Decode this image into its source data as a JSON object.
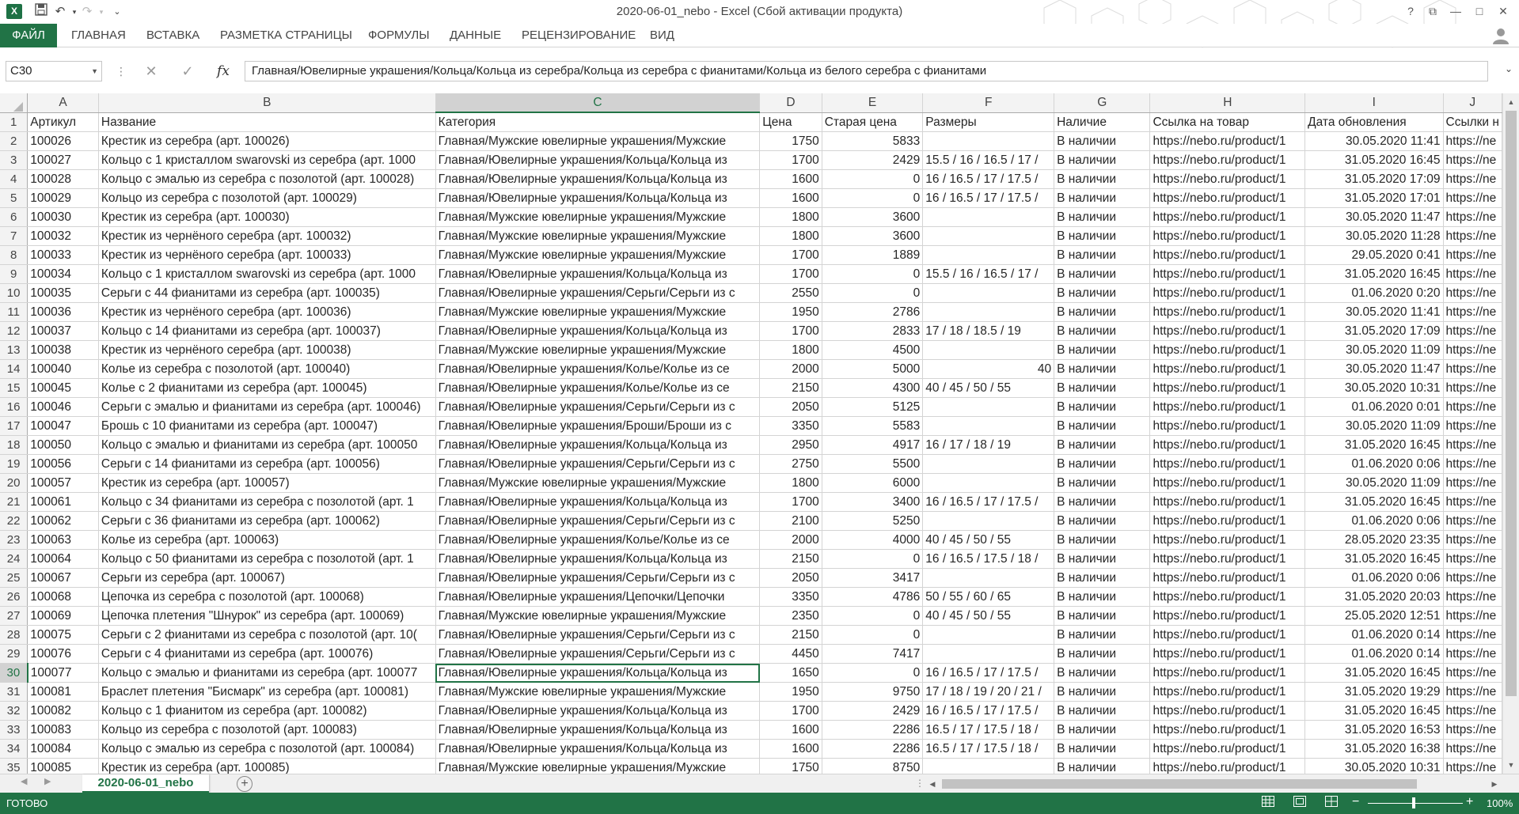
{
  "window": {
    "title": "2020-06-01_nebo - Excel (Сбой активации продукта)",
    "app_icon": "X",
    "help": "?",
    "restore": "⧉",
    "minimize": "—",
    "maximize": "□",
    "close": "✕"
  },
  "qat": {
    "save_icon": "💾",
    "undo_icon": "↶",
    "redo_icon": "↷",
    "customize_icon": "⌄"
  },
  "ribbon": {
    "tabs": [
      "ФАЙЛ",
      "ГЛАВНАЯ",
      "ВСТАВКА",
      "РАЗМЕТКА СТРАНИЦЫ",
      "ФОРМУЛЫ",
      "ДАННЫЕ",
      "РЕЦЕНЗИРОВАНИЕ",
      "ВИД"
    ]
  },
  "formula_bar": {
    "name_box": "C30",
    "cancel": "✕",
    "enter": "✓",
    "fx": "fx",
    "formula": "Главная/Ювелирные украшения/Кольца/Кольца из серебра/Кольца из серебра с фианитами/Кольца из белого серебра с фианитами"
  },
  "columns": [
    "A",
    "B",
    "C",
    "D",
    "E",
    "F",
    "G",
    "H",
    "I",
    "J"
  ],
  "selected_column": "C",
  "selected_row": 30,
  "header_row": [
    "Артикул",
    "Название",
    "Категория",
    "Цена",
    "Старая цена",
    "Размеры",
    "Наличие",
    "Ссылка на товар",
    "Дата обновления",
    "Ссылки н"
  ],
  "rows": [
    [
      "100026",
      "Крестик из серебра (арт. 100026)",
      "Главная/Мужские ювелирные украшения/Мужские",
      "1750",
      "5833",
      "",
      "В наличии",
      "https://nebo.ru/product/1",
      "30.05.2020 11:41",
      "https://ne"
    ],
    [
      "100027",
      "Кольцо с 1 кристаллом swarovski из серебра (арт. 1000",
      "Главная/Ювелирные украшения/Кольца/Кольца из",
      "1700",
      "2429",
      "15.5 / 16 / 16.5 / 17 /",
      "В наличии",
      "https://nebo.ru/product/1",
      "31.05.2020 16:45",
      "https://ne"
    ],
    [
      "100028",
      "Кольцо с эмалью из серебра с позолотой (арт. 100028)",
      "Главная/Ювелирные украшения/Кольца/Кольца из",
      "1600",
      "0",
      "16 / 16.5 / 17 / 17.5 /",
      "В наличии",
      "https://nebo.ru/product/1",
      "31.05.2020 17:09",
      "https://ne"
    ],
    [
      "100029",
      "Кольцо из серебра с позолотой (арт. 100029)",
      "Главная/Ювелирные украшения/Кольца/Кольца из",
      "1600",
      "0",
      "16 / 16.5 / 17 / 17.5 /",
      "В наличии",
      "https://nebo.ru/product/1",
      "31.05.2020 17:01",
      "https://ne"
    ],
    [
      "100030",
      "Крестик из серебра (арт. 100030)",
      "Главная/Мужские ювелирные украшения/Мужские",
      "1800",
      "3600",
      "",
      "В наличии",
      "https://nebo.ru/product/1",
      "30.05.2020 11:47",
      "https://ne"
    ],
    [
      "100032",
      "Крестик из чернёного серебра (арт. 100032)",
      "Главная/Мужские ювелирные украшения/Мужские",
      "1800",
      "3600",
      "",
      "В наличии",
      "https://nebo.ru/product/1",
      "30.05.2020 11:28",
      "https://ne"
    ],
    [
      "100033",
      "Крестик из чернёного серебра (арт. 100033)",
      "Главная/Мужские ювелирные украшения/Мужские",
      "1700",
      "1889",
      "",
      "В наличии",
      "https://nebo.ru/product/1",
      "29.05.2020 0:41",
      "https://ne"
    ],
    [
      "100034",
      "Кольцо с 1 кристаллом swarovski из серебра (арт. 1000",
      "Главная/Ювелирные украшения/Кольца/Кольца из",
      "1700",
      "0",
      "15.5 / 16 / 16.5 / 17 /",
      "В наличии",
      "https://nebo.ru/product/1",
      "31.05.2020 16:45",
      "https://ne"
    ],
    [
      "100035",
      "Серьги с 44 фианитами из серебра (арт. 100035)",
      "Главная/Ювелирные украшения/Серьги/Серьги из с",
      "2550",
      "0",
      "",
      "В наличии",
      "https://nebo.ru/product/1",
      "01.06.2020 0:20",
      "https://ne"
    ],
    [
      "100036",
      "Крестик из чернёного серебра (арт. 100036)",
      "Главная/Мужские ювелирные украшения/Мужские",
      "1950",
      "2786",
      "",
      "В наличии",
      "https://nebo.ru/product/1",
      "30.05.2020 11:41",
      "https://ne"
    ],
    [
      "100037",
      "Кольцо с 14 фианитами из серебра (арт. 100037)",
      "Главная/Ювелирные украшения/Кольца/Кольца из",
      "1700",
      "2833",
      "17 / 18 / 18.5 / 19",
      "В наличии",
      "https://nebo.ru/product/1",
      "31.05.2020 17:09",
      "https://ne"
    ],
    [
      "100038",
      "Крестик из чернёного серебра (арт. 100038)",
      "Главная/Мужские ювелирные украшения/Мужские",
      "1800",
      "4500",
      "",
      "В наличии",
      "https://nebo.ru/product/1",
      "30.05.2020 11:09",
      "https://ne"
    ],
    [
      "100040",
      "Колье из серебра с позолотой (арт. 100040)",
      "Главная/Ювелирные украшения/Колье/Колье из се",
      "2000",
      "5000",
      "40",
      "В наличии",
      "https://nebo.ru/product/1",
      "30.05.2020 11:47",
      "https://ne"
    ],
    [
      "100045",
      "Колье с 2 фианитами из серебра (арт. 100045)",
      "Главная/Ювелирные украшения/Колье/Колье из се",
      "2150",
      "4300",
      "40 / 45 / 50 / 55",
      "В наличии",
      "https://nebo.ru/product/1",
      "30.05.2020 10:31",
      "https://ne"
    ],
    [
      "100046",
      "Серьги с эмалью и фианитами из серебра (арт. 100046)",
      "Главная/Ювелирные украшения/Серьги/Серьги из с",
      "2050",
      "5125",
      "",
      "В наличии",
      "https://nebo.ru/product/1",
      "01.06.2020 0:01",
      "https://ne"
    ],
    [
      "100047",
      "Брошь с 10 фианитами из серебра (арт. 100047)",
      "Главная/Ювелирные украшения/Броши/Броши из с",
      "3350",
      "5583",
      "",
      "В наличии",
      "https://nebo.ru/product/1",
      "30.05.2020 11:09",
      "https://ne"
    ],
    [
      "100050",
      "Кольцо с эмалью и фианитами из серебра (арт. 100050",
      "Главная/Ювелирные украшения/Кольца/Кольца из",
      "2950",
      "4917",
      "16 / 17 / 18 / 19",
      "В наличии",
      "https://nebo.ru/product/1",
      "31.05.2020 16:45",
      "https://ne"
    ],
    [
      "100056",
      "Серьги с 14 фианитами из серебра (арт. 100056)",
      "Главная/Ювелирные украшения/Серьги/Серьги из с",
      "2750",
      "5500",
      "",
      "В наличии",
      "https://nebo.ru/product/1",
      "01.06.2020 0:06",
      "https://ne"
    ],
    [
      "100057",
      "Крестик из серебра (арт. 100057)",
      "Главная/Мужские ювелирные украшения/Мужские",
      "1800",
      "6000",
      "",
      "В наличии",
      "https://nebo.ru/product/1",
      "30.05.2020 11:09",
      "https://ne"
    ],
    [
      "100061",
      "Кольцо с 34 фианитами из серебра с позолотой (арт. 1",
      "Главная/Ювелирные украшения/Кольца/Кольца из",
      "1700",
      "3400",
      "16 / 16.5 / 17 / 17.5 /",
      "В наличии",
      "https://nebo.ru/product/1",
      "31.05.2020 16:45",
      "https://ne"
    ],
    [
      "100062",
      "Серьги с 36 фианитами из серебра (арт. 100062)",
      "Главная/Ювелирные украшения/Серьги/Серьги из с",
      "2100",
      "5250",
      "",
      "В наличии",
      "https://nebo.ru/product/1",
      "01.06.2020 0:06",
      "https://ne"
    ],
    [
      "100063",
      "Колье из серебра (арт. 100063)",
      "Главная/Ювелирные украшения/Колье/Колье из се",
      "2000",
      "4000",
      "40 / 45 / 50 / 55",
      "В наличии",
      "https://nebo.ru/product/1",
      "28.05.2020 23:35",
      "https://ne"
    ],
    [
      "100064",
      "Кольцо с 50 фианитами из серебра с позолотой (арт. 1",
      "Главная/Ювелирные украшения/Кольца/Кольца из",
      "2150",
      "0",
      "16 / 16.5 / 17.5 / 18 /",
      "В наличии",
      "https://nebo.ru/product/1",
      "31.05.2020 16:45",
      "https://ne"
    ],
    [
      "100067",
      "Серьги из серебра (арт. 100067)",
      "Главная/Ювелирные украшения/Серьги/Серьги из с",
      "2050",
      "3417",
      "",
      "В наличии",
      "https://nebo.ru/product/1",
      "01.06.2020 0:06",
      "https://ne"
    ],
    [
      "100068",
      "Цепочка из серебра с позолотой (арт. 100068)",
      "Главная/Ювелирные украшения/Цепочки/Цепочки",
      "3350",
      "4786",
      "50 / 55 / 60 / 65",
      "В наличии",
      "https://nebo.ru/product/1",
      "31.05.2020 20:03",
      "https://ne"
    ],
    [
      "100069",
      "Цепочка плетения \"Шнурок\" из серебра (арт. 100069)",
      "Главная/Мужские ювелирные украшения/Мужские",
      "2350",
      "0",
      "40 / 45 / 50 / 55",
      "В наличии",
      "https://nebo.ru/product/1",
      "25.05.2020 12:51",
      "https://ne"
    ],
    [
      "100075",
      "Серьги с 2 фианитами из серебра с позолотой (арт. 10(",
      "Главная/Ювелирные украшения/Серьги/Серьги из с",
      "2150",
      "0",
      "",
      "В наличии",
      "https://nebo.ru/product/1",
      "01.06.2020 0:14",
      "https://ne"
    ],
    [
      "100076",
      "Серьги с 4 фианитами из серебра (арт. 100076)",
      "Главная/Ювелирные украшения/Серьги/Серьги из с",
      "4450",
      "7417",
      "",
      "В наличии",
      "https://nebo.ru/product/1",
      "01.06.2020 0:14",
      "https://ne"
    ],
    [
      "100077",
      "Кольцо с эмалью и фианитами из серебра (арт. 100077",
      "Главная/Ювелирные украшения/Кольца/Кольца из",
      "1650",
      "0",
      "16 / 16.5 / 17 / 17.5 /",
      "В наличии",
      "https://nebo.ru/product/1",
      "31.05.2020 16:45",
      "https://ne"
    ],
    [
      "100081",
      "Браслет плетения \"Бисмарк\" из серебра (арт. 100081)",
      "Главная/Мужские ювелирные украшения/Мужские",
      "1950",
      "9750",
      "17 / 18 / 19 / 20 / 21 /",
      "В наличии",
      "https://nebo.ru/product/1",
      "31.05.2020 19:29",
      "https://ne"
    ],
    [
      "100082",
      "Кольцо с 1 фианитом из серебра (арт. 100082)",
      "Главная/Ювелирные украшения/Кольца/Кольца из",
      "1700",
      "2429",
      "16 / 16.5 / 17 / 17.5 /",
      "В наличии",
      "https://nebo.ru/product/1",
      "31.05.2020 16:45",
      "https://ne"
    ],
    [
      "100083",
      "Кольцо из серебра с позолотой (арт. 100083)",
      "Главная/Ювелирные украшения/Кольца/Кольца из",
      "1600",
      "2286",
      "16.5 / 17 / 17.5 / 18 /",
      "В наличии",
      "https://nebo.ru/product/1",
      "31.05.2020 16:53",
      "https://ne"
    ],
    [
      "100084",
      "Кольцо с эмалью из серебра с позолотой (арт. 100084)",
      "Главная/Ювелирные украшения/Кольца/Кольца из",
      "1600",
      "2286",
      "16.5 / 17 / 17.5 / 18 /",
      "В наличии",
      "https://nebo.ru/product/1",
      "31.05.2020 16:38",
      "https://ne"
    ],
    [
      "100085",
      "Крестик из серебра (арт. 100085)",
      "Главная/Мужские ювелирные украшения/Мужские",
      "1750",
      "8750",
      "",
      "В наличии",
      "https://nebo.ru/product/1",
      "30.05.2020 10:31",
      "https://ne"
    ]
  ],
  "sheet_tabs": {
    "active": "2020-06-01_nebo",
    "add": "+"
  },
  "status": {
    "ready": "ГОТОВО",
    "zoom": "100%",
    "zoom_level_percent": 100
  },
  "colors": {
    "excel_green": "#217346",
    "status_bar": "#217346"
  }
}
